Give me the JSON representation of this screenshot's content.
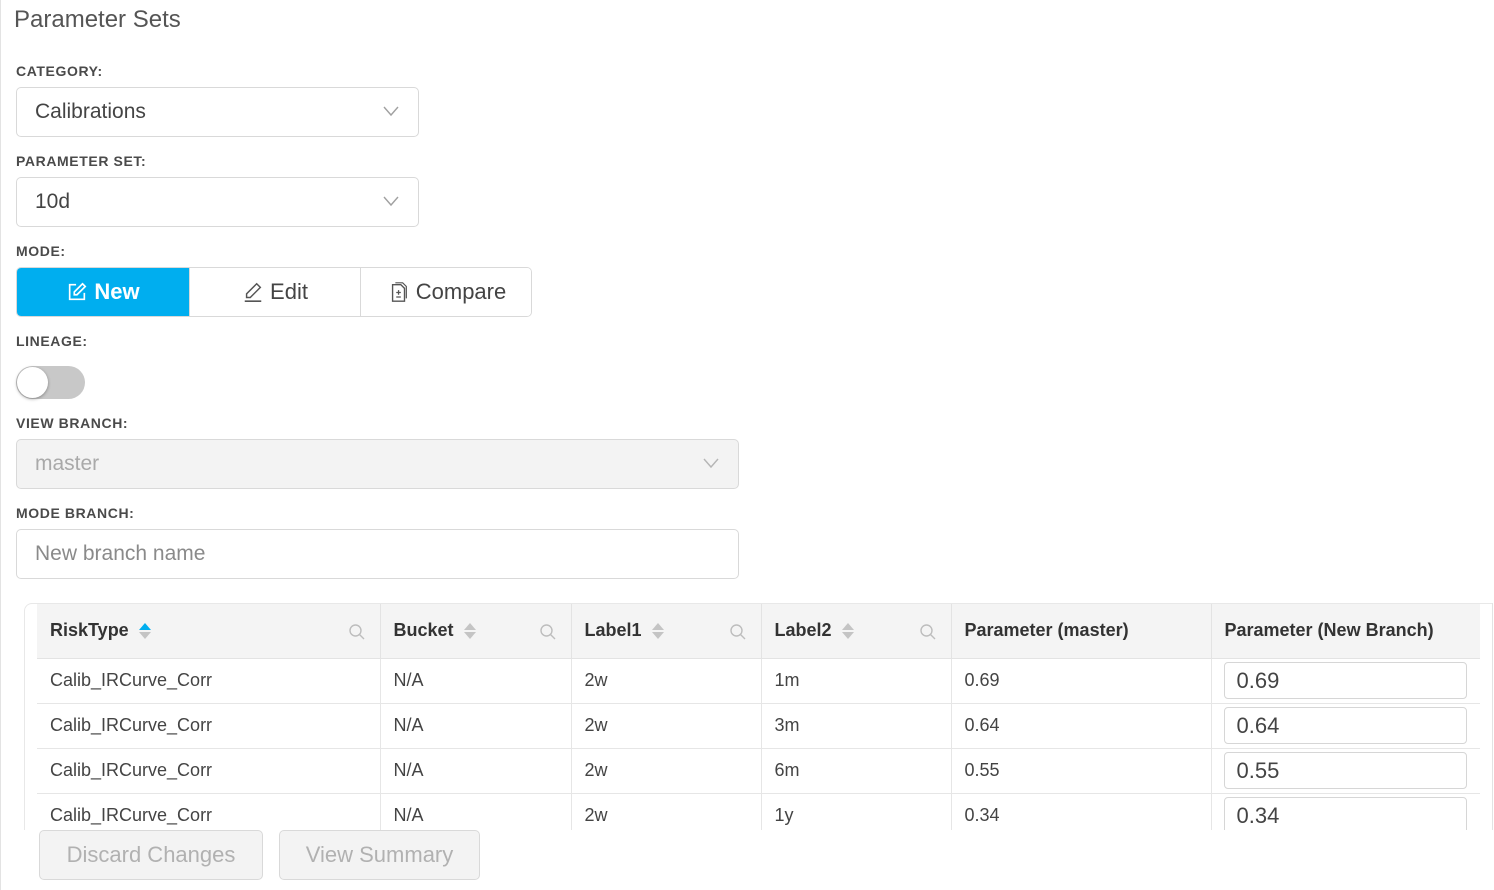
{
  "page": {
    "title": "Parameter Sets"
  },
  "category": {
    "label": "CATEGORY:",
    "value": "Calibrations"
  },
  "parameter_set": {
    "label": "PARAMETER SET:",
    "value": "10d"
  },
  "mode": {
    "label": "MODE:",
    "options": [
      {
        "label": "New",
        "icon": "edit-square-icon",
        "active": true
      },
      {
        "label": "Edit",
        "icon": "pencil-icon",
        "active": false
      },
      {
        "label": "Compare",
        "icon": "diff-document-icon",
        "active": false
      }
    ],
    "accent_color": "#00aeef"
  },
  "lineage": {
    "label": "LINEAGE:",
    "enabled": false
  },
  "view_branch": {
    "label": "VIEW BRANCH:",
    "value": "master",
    "disabled": true
  },
  "mode_branch": {
    "label": "MODE BRANCH:",
    "placeholder": "New branch name",
    "value": ""
  },
  "table": {
    "columns": [
      {
        "label": "RiskType",
        "sortable": true,
        "sort": "asc",
        "searchable": true
      },
      {
        "label": "Bucket",
        "sortable": true,
        "sort": "none",
        "searchable": true
      },
      {
        "label": "Label1",
        "sortable": true,
        "sort": "none",
        "searchable": true
      },
      {
        "label": "Label2",
        "sortable": true,
        "sort": "none",
        "searchable": true
      },
      {
        "label": "Parameter (master)",
        "sortable": false,
        "searchable": false
      },
      {
        "label": "Parameter (New Branch)",
        "sortable": false,
        "searchable": false
      }
    ],
    "rows": [
      {
        "risk_type": "Calib_IRCurve_Corr",
        "bucket": "N/A",
        "label1": "2w",
        "label2": "1m",
        "param_master": "0.69",
        "param_new": "0.69"
      },
      {
        "risk_type": "Calib_IRCurve_Corr",
        "bucket": "N/A",
        "label1": "2w",
        "label2": "3m",
        "param_master": "0.64",
        "param_new": "0.64"
      },
      {
        "risk_type": "Calib_IRCurve_Corr",
        "bucket": "N/A",
        "label1": "2w",
        "label2": "6m",
        "param_master": "0.55",
        "param_new": "0.55"
      },
      {
        "risk_type": "Calib_IRCurve_Corr",
        "bucket": "N/A",
        "label1": "2w",
        "label2": "1y",
        "param_master": "0.34",
        "param_new": "0.34"
      }
    ]
  },
  "actions": {
    "discard_label": "Discard Changes",
    "summary_label": "View Summary"
  }
}
